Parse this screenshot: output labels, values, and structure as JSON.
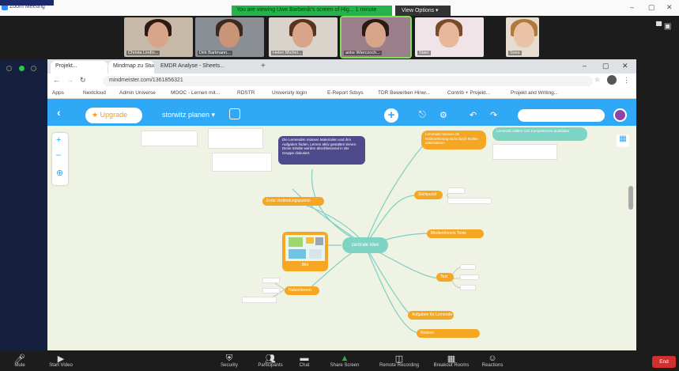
{
  "titlebar": {
    "app_name": "Zoom Meeting"
  },
  "share_banner": {
    "text": "You are viewing Uwe Barbenik's screen of Hig... 1 minute",
    "view_options": "View Options ▾"
  },
  "gallery": {
    "participants": [
      {
        "name": "Christa Lindlo..."
      },
      {
        "name": "Dirk Bartmann..."
      },
      {
        "name": "Helen Michel..."
      },
      {
        "name": "anke Wierczoch..."
      },
      {
        "name": "Stani"
      },
      {
        "name": "Svea"
      }
    ]
  },
  "browser": {
    "tabs": [
      {
        "label": "Projekt..."
      },
      {
        "label": "Mindmap zu Stud..."
      },
      {
        "label": "EMDR Analyse - Sheets..."
      }
    ],
    "url": "mindmeister.com/1361856321",
    "bookmarks": [
      "Apps",
      "Nextcloud",
      "Admin Universe",
      "MOOC - Lernen mit...",
      "RDSTR",
      "University login",
      "E-Report Sdsys",
      "TDR Bewerben Hinw...",
      "Contrib + Projekt...",
      "Projekt and Writing..."
    ]
  },
  "app": {
    "upgrade_label": "Upgrade",
    "map_title": "storwitz planen ▾",
    "icons": {
      "back": "back-arrow-icon",
      "add": "add-circle-icon",
      "share": "share-icon",
      "undo": "undo-icon",
      "redo": "redo-icon",
      "search": "search-icon"
    }
  },
  "mindmap": {
    "central": "zentrale Idee",
    "image_node_label": "Bild",
    "nodes": [
      {
        "id": "n1",
        "text": "Erste Verbindungspunkte"
      },
      {
        "id": "n2",
        "text": "Stichpunkt"
      },
      {
        "id": "n3",
        "text": "Medientheorie Texte"
      },
      {
        "id": "n4",
        "text": "Text"
      },
      {
        "id": "n5",
        "text": "Nutzerlernen"
      },
      {
        "id": "n6",
        "text": "Aufgaben für Lernende"
      },
      {
        "id": "n7",
        "text": "Notizen"
      },
      {
        "id": "n8",
        "text": "Lernende müssen die Wahrnehmung nicht durch Rollen unterstützen"
      }
    ],
    "purple_note": "Die Lernenden müssen Materialien und ihre Aufgaben finden, Lernen aktiv gestalten lernen. Diese Inhalte werden abschliessend in der Gruppe diskutiert.",
    "teal_note": "Lernende sollten sich Kompetenzen ausbilden"
  },
  "bottombar": {
    "items": [
      {
        "label": "Mute",
        "icon": "microphone-icon"
      },
      {
        "label": "Start Video",
        "icon": "camera-icon"
      },
      {
        "label": "Security",
        "icon": "shield-icon"
      },
      {
        "label": "Participants",
        "icon": "participants-icon"
      },
      {
        "label": "Chat",
        "icon": "chat-icon"
      },
      {
        "label": "Share Screen",
        "icon": "share-screen-icon"
      },
      {
        "label": "Remote Recording",
        "icon": "record-icon"
      },
      {
        "label": "Breakout Rooms",
        "icon": "breakout-icon"
      },
      {
        "label": "Reactions",
        "icon": "reactions-icon"
      }
    ],
    "end_label": "End"
  }
}
